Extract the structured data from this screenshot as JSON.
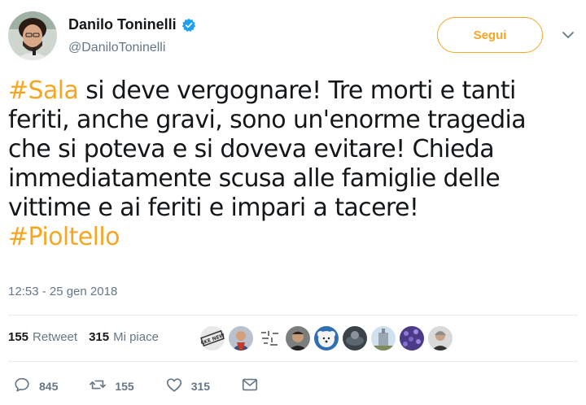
{
  "author": {
    "display_name": "Danilo Toninelli",
    "handle": "@DaniloToninelli",
    "verified_icon": "verified-badge-icon"
  },
  "follow_button_label": "Segui",
  "accent_color": "#f5a623",
  "tweet": {
    "lines": [
      [
        {
          "hashtag": "#Sala"
        },
        {
          "text": " si deve vergognare! Tre morti e tanti"
        }
      ],
      [
        {
          "text": "feriti, anche gravi, sono un'enorme tragedia"
        }
      ],
      [
        {
          "text": "che si poteva e si doveva evitare! Chieda"
        }
      ],
      [
        {
          "text": "immediatamente scusa alle famiglie delle"
        }
      ],
      [
        {
          "text": "vittime e ai feriti e impari a tacere!"
        }
      ],
      [
        {
          "hashtag": "#Pioltello"
        }
      ]
    ]
  },
  "timestamp": "12:53 - 25 gen 2018",
  "stats": {
    "retweets_count": "155",
    "retweets_label": "Retweet",
    "likes_count": "315",
    "likes_label": "Mi piace"
  },
  "liker_avatars": [
    {
      "icon": "fake-news-badge-avatar",
      "text": "FAKE NEWS"
    },
    {
      "icon": "person-avatar"
    },
    {
      "icon": "pattern-avatar"
    },
    {
      "icon": "person-avatar"
    },
    {
      "icon": "dog-avatar"
    },
    {
      "icon": "dark-avatar"
    },
    {
      "icon": "building-avatar"
    },
    {
      "icon": "purple-flowers-avatar"
    },
    {
      "icon": "person-avatar"
    }
  ],
  "actions": {
    "reply_count": "845",
    "retweet_count": "155",
    "like_count": "315"
  }
}
